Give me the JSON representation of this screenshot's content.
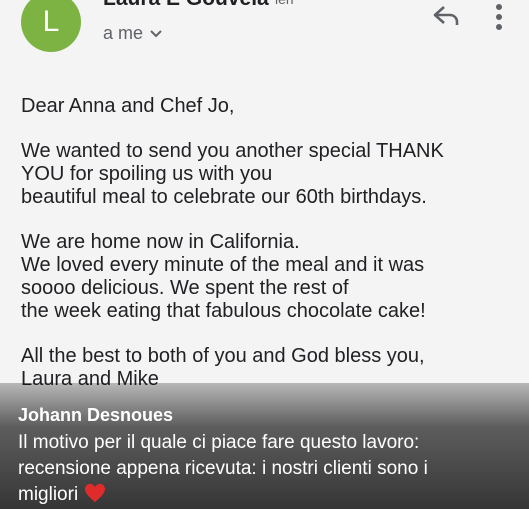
{
  "email": {
    "avatar_letter": "L",
    "sender_name": "Laura E Gouveia",
    "time": "ieri",
    "recipient": "a me",
    "icons": {
      "reply": "reply-icon",
      "more": "more-vert-icon",
      "expand": "chevron-down-icon"
    },
    "colors": {
      "avatar": "#7cb342"
    },
    "body": {
      "greeting": "Dear Anna and Chef Jo,",
      "paragraph1": [
        "We wanted to send you another special THANK",
        "YOU for spoiling us with you",
        "beautiful meal to celebrate our 60th birthdays."
      ],
      "paragraph2": [
        "We are home now in California.",
        "We loved every minute of the meal and it was",
        "soooo delicious. We spent the rest of",
        "the week eating that fabulous chocolate cake!"
      ],
      "paragraph3": [
        "All the best to both of you and God bless you,",
        "Laura and Mike"
      ]
    }
  },
  "post": {
    "author": "Johann Desnoues",
    "caption_lines": [
      "Il motivo per il quale ci piace fare questo lavoro:",
      "recensione appena ricevuta: i nostri clienti sono i",
      "migliori"
    ],
    "emoji": "heart-icon"
  }
}
